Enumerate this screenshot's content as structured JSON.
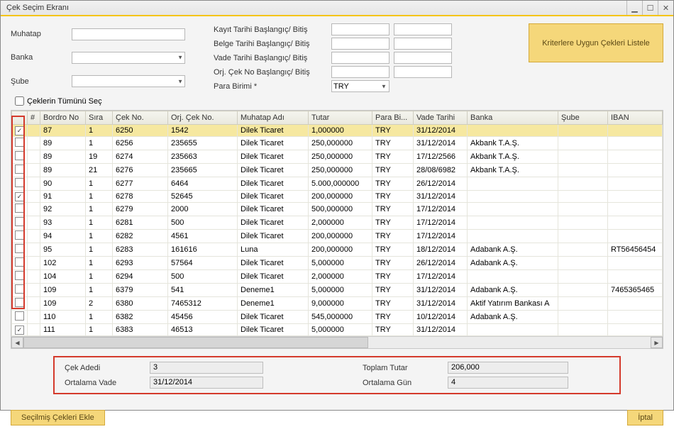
{
  "window": {
    "title": "Çek Seçim Ekranı"
  },
  "filters": {
    "muhatap_label": "Muhatap",
    "banka_label": "Banka",
    "sube_label": "Şube",
    "kayit_label": "Kayıt Tarihi Başlangıç/ Bitiş",
    "belge_label": "Belge Tarihi Başlangıç/ Bitiş",
    "vade_label": "Vade Tarihi Başlangıç/ Bitiş",
    "orjcek_label": "Orj. Çek No Başlangıç/ Bitiş",
    "para_label": "Para Birimi *",
    "para_value": "TRY",
    "muhatap_value": "",
    "banka_value": "",
    "sube_value": "",
    "list_button": "Kriterlere Uygun Çekleri Listele",
    "select_all": "Çeklerin Tümünü Seç"
  },
  "grid": {
    "headers": {
      "hash": "#",
      "bordro": "Bordro No",
      "sira": "Sıra",
      "cekno": "Çek No.",
      "orjcek": "Orj. Çek No.",
      "muhatap": "Muhatap Adı",
      "tutar": "Tutar",
      "parabi": "Para Bi...",
      "vade": "Vade Tarihi",
      "banka": "Banka",
      "sube": "Şube",
      "iban": "IBAN"
    },
    "rows": [
      {
        "chk": true,
        "bordro": "87",
        "sira": "1",
        "cekno": "6250",
        "orj": "1542",
        "muhatap": "Dilek Ticaret",
        "tutar": "1,000000",
        "pb": "TRY",
        "vade": "31/12/2014",
        "banka": "",
        "sube": "",
        "iban": ""
      },
      {
        "chk": false,
        "bordro": "89",
        "sira": "1",
        "cekno": "6256",
        "orj": "235655",
        "muhatap": "Dilek Ticaret",
        "tutar": "250,000000",
        "pb": "TRY",
        "vade": "31/12/2014",
        "banka": "Akbank T.A.Ş.",
        "sube": "",
        "iban": ""
      },
      {
        "chk": false,
        "bordro": "89",
        "sira": "19",
        "cekno": "6274",
        "orj": "235663",
        "muhatap": "Dilek Ticaret",
        "tutar": "250,000000",
        "pb": "TRY",
        "vade": "17/12/2566",
        "banka": "Akbank T.A.Ş.",
        "sube": "",
        "iban": ""
      },
      {
        "chk": false,
        "bordro": "89",
        "sira": "21",
        "cekno": "6276",
        "orj": "235665",
        "muhatap": "Dilek Ticaret",
        "tutar": "250,000000",
        "pb": "TRY",
        "vade": "28/08/6982",
        "banka": "Akbank T.A.Ş.",
        "sube": "",
        "iban": ""
      },
      {
        "chk": false,
        "bordro": "90",
        "sira": "1",
        "cekno": "6277",
        "orj": "6464",
        "muhatap": "Dilek Ticaret",
        "tutar": "5.000,000000",
        "pb": "TRY",
        "vade": "26/12/2014",
        "banka": "",
        "sube": "",
        "iban": ""
      },
      {
        "chk": true,
        "bordro": "91",
        "sira": "1",
        "cekno": "6278",
        "orj": "52645",
        "muhatap": "Dilek Ticaret",
        "tutar": "200,000000",
        "pb": "TRY",
        "vade": "31/12/2014",
        "banka": "",
        "sube": "",
        "iban": ""
      },
      {
        "chk": false,
        "bordro": "92",
        "sira": "1",
        "cekno": "6279",
        "orj": "2000",
        "muhatap": "Dilek Ticaret",
        "tutar": "500,000000",
        "pb": "TRY",
        "vade": "17/12/2014",
        "banka": "",
        "sube": "",
        "iban": ""
      },
      {
        "chk": false,
        "bordro": "93",
        "sira": "1",
        "cekno": "6281",
        "orj": "500",
        "muhatap": "Dilek Ticaret",
        "tutar": "2,000000",
        "pb": "TRY",
        "vade": "17/12/2014",
        "banka": "",
        "sube": "",
        "iban": ""
      },
      {
        "chk": false,
        "bordro": "94",
        "sira": "1",
        "cekno": "6282",
        "orj": "4561",
        "muhatap": "Dilek Ticaret",
        "tutar": "200,000000",
        "pb": "TRY",
        "vade": "17/12/2014",
        "banka": "",
        "sube": "",
        "iban": ""
      },
      {
        "chk": false,
        "bordro": "95",
        "sira": "1",
        "cekno": "6283",
        "orj": "161616",
        "muhatap": "Luna",
        "tutar": "200,000000",
        "pb": "TRY",
        "vade": "18/12/2014",
        "banka": "Adabank A.Ş.",
        "sube": "",
        "iban": "RT56456454"
      },
      {
        "chk": false,
        "bordro": "102",
        "sira": "1",
        "cekno": "6293",
        "orj": "57564",
        "muhatap": "Dilek Ticaret",
        "tutar": "5,000000",
        "pb": "TRY",
        "vade": "26/12/2014",
        "banka": "Adabank A.Ş.",
        "sube": "",
        "iban": ""
      },
      {
        "chk": false,
        "bordro": "104",
        "sira": "1",
        "cekno": "6294",
        "orj": "500",
        "muhatap": "Dilek Ticaret",
        "tutar": "2,000000",
        "pb": "TRY",
        "vade": "17/12/2014",
        "banka": "",
        "sube": "",
        "iban": ""
      },
      {
        "chk": false,
        "bordro": "109",
        "sira": "1",
        "cekno": "6379",
        "orj": "541",
        "muhatap": "Deneme1",
        "tutar": "5,000000",
        "pb": "TRY",
        "vade": "31/12/2014",
        "banka": "Adabank A.Ş.",
        "sube": "",
        "iban": "7465365465"
      },
      {
        "chk": false,
        "bordro": "109",
        "sira": "2",
        "cekno": "6380",
        "orj": "7465312",
        "muhatap": "Deneme1",
        "tutar": "9,000000",
        "pb": "TRY",
        "vade": "31/12/2014",
        "banka": "Aktif Yatırım Bankası A",
        "sube": "",
        "iban": ""
      },
      {
        "chk": false,
        "bordro": "110",
        "sira": "1",
        "cekno": "6382",
        "orj": "45456",
        "muhatap": "Dilek Ticaret",
        "tutar": "545,000000",
        "pb": "TRY",
        "vade": "10/12/2014",
        "banka": "Adabank A.Ş.",
        "sube": "",
        "iban": ""
      },
      {
        "chk": true,
        "bordro": "111",
        "sira": "1",
        "cekno": "6383",
        "orj": "46513",
        "muhatap": "Dilek Ticaret",
        "tutar": "5,000000",
        "pb": "TRY",
        "vade": "31/12/2014",
        "banka": "",
        "sube": "",
        "iban": ""
      }
    ]
  },
  "summary": {
    "cek_adedi_label": "Çek Adedi",
    "cek_adedi_value": "3",
    "ortalama_vade_label": "Ortalama Vade",
    "ortalama_vade_value": "31/12/2014",
    "toplam_tutar_label": "Toplam Tutar",
    "toplam_tutar_value": "206,000",
    "ortalama_gun_label": "Ortalama Gün",
    "ortalama_gun_value": "4"
  },
  "footer": {
    "add_button": "Seçilmiş Çekleri Ekle",
    "cancel_button": "İptal"
  }
}
